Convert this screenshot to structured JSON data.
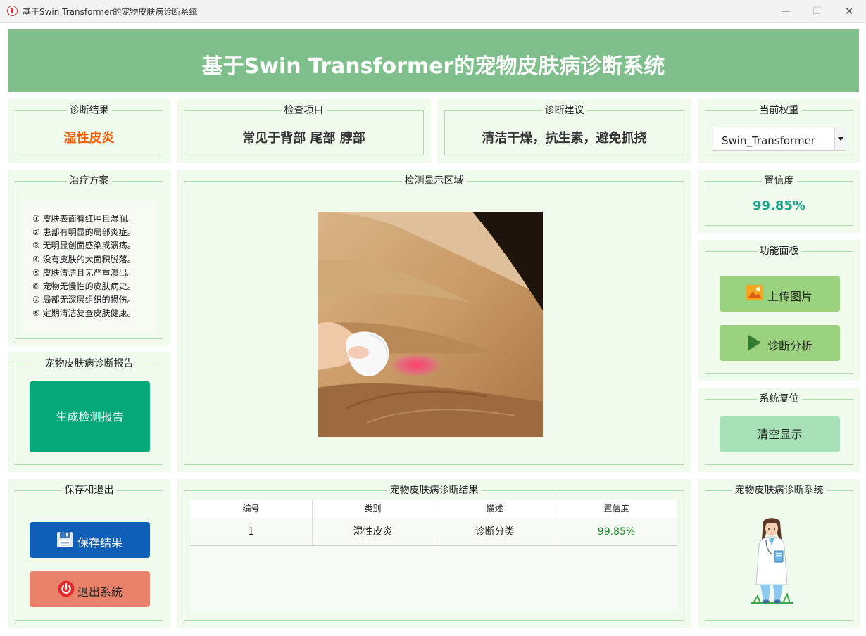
{
  "window": {
    "title": "基于Swin Transformer的宠物皮肤病诊断系统",
    "min_glyph": "—",
    "max_glyph": "☐",
    "close_glyph": "✕"
  },
  "banner": {
    "title": "基于Swin Transformer的宠物皮肤病诊断系统"
  },
  "result": {
    "title": "诊断结果",
    "value": "湿性皮炎",
    "color": "#ff5a00"
  },
  "check": {
    "title": "检查项目",
    "value": "常见于背部 尾部 脖部"
  },
  "advice": {
    "title": "诊断建议",
    "value": "清洁干燥，抗生素，避免抓挠"
  },
  "weights": {
    "title": "当前权重",
    "selected": "Swin_Transformer"
  },
  "treatment": {
    "title": "治疗方案",
    "items": [
      "① 皮肤表面有红肿且湿润。",
      "② 患部有明显的局部炎症。",
      "③ 无明显创面感染或溃疡。",
      "④ 没有皮肤的大面积脱落。",
      "⑤ 皮肤清洁且无严重渗出。",
      "⑥ 宠物无慢性的皮肤病史。",
      "⑦ 局部无深层组织的损伤。",
      "⑧ 定期清洁复查皮肤健康。"
    ]
  },
  "detect": {
    "title": "检测显示区域"
  },
  "confidence": {
    "title": "置信度",
    "value": "99.85%",
    "color": "#1aa58a"
  },
  "functions": {
    "title": "功能面板",
    "upload_label": "上传图片",
    "analyze_label": "诊断分析"
  },
  "report": {
    "title": "宠物皮肤病诊断报告",
    "button_label": "生成检测报告"
  },
  "reset": {
    "title": "系统复位",
    "button_label": "清空显示"
  },
  "save_exit": {
    "title": "保存和退出",
    "save_label": "保存结果",
    "exit_label": "退出系统"
  },
  "results_table": {
    "title": "宠物皮肤病诊断结果",
    "columns": [
      "编号",
      "类别",
      "描述",
      "置信度"
    ],
    "rows": [
      {
        "id": "1",
        "category": "湿性皮炎",
        "description": "诊断分类",
        "confidence": "99.85%"
      }
    ]
  },
  "mascot": {
    "title": "宠物皮肤病诊断系统"
  },
  "colors": {
    "banner": "#7ebf8b",
    "panel": "#f0fbee",
    "button_green": "#9bd27f",
    "report_button": "#06a879",
    "save_button": "#0f5eb8",
    "exit_button": "#e8826b",
    "clear_button": "#a8e0b8"
  }
}
